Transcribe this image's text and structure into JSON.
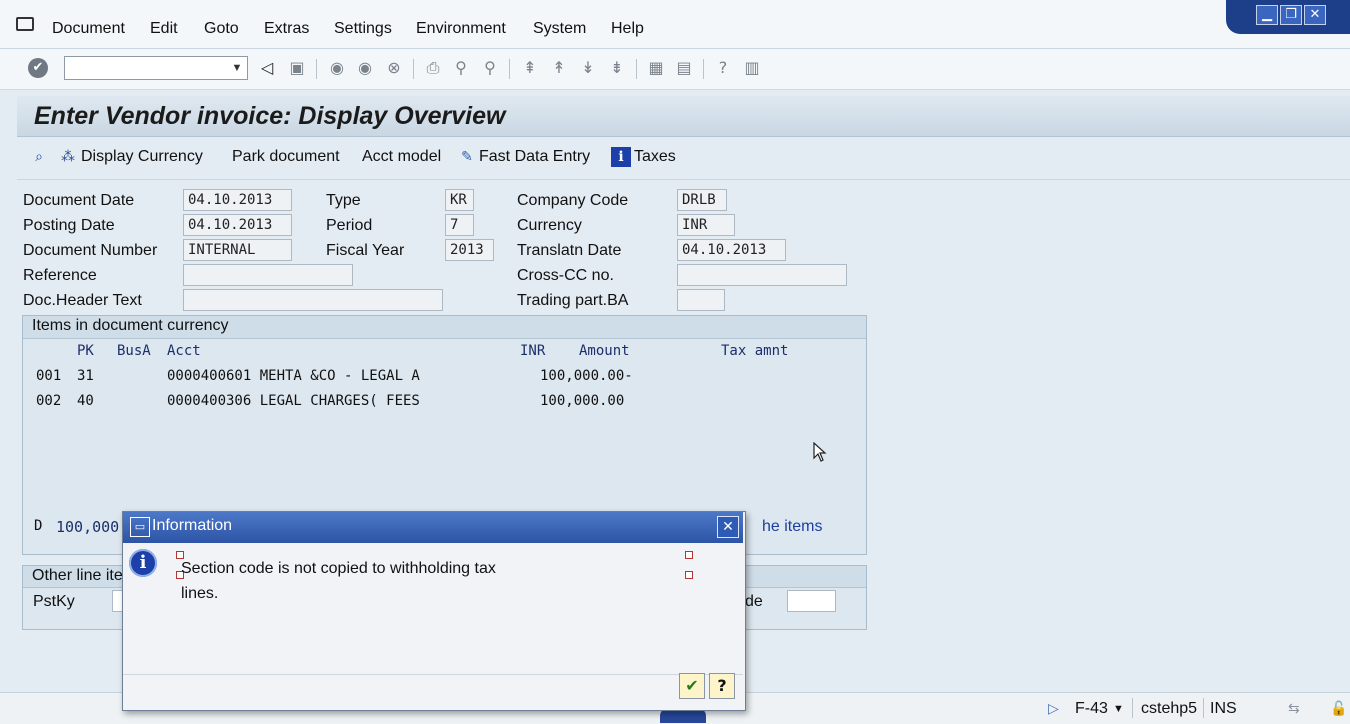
{
  "menu": {
    "items": [
      "Document",
      "Edit",
      "Goto",
      "Extras",
      "Settings",
      "Environment",
      "System",
      "Help"
    ]
  },
  "toolbar": {
    "command_field_value": ""
  },
  "window_controls": {
    "minimize": "▁",
    "restore": "❐",
    "close": "✕"
  },
  "page": {
    "title": "Enter Vendor invoice: Display Overview"
  },
  "app_toolbar": {
    "display_currency": "Display Currency",
    "park_document": "Park document",
    "acct_model": "Acct model",
    "fast_data_entry": "Fast Data Entry",
    "taxes": "Taxes"
  },
  "header": {
    "document_date": {
      "label": "Document Date",
      "value": "04.10.2013"
    },
    "posting_date": {
      "label": "Posting Date",
      "value": "04.10.2013"
    },
    "document_number": {
      "label": "Document Number",
      "value": "INTERNAL"
    },
    "reference": {
      "label": "Reference",
      "value": ""
    },
    "doc_header_text": {
      "label": "Doc.Header Text",
      "value": ""
    },
    "type": {
      "label": "Type",
      "value": "KR"
    },
    "period": {
      "label": "Period",
      "value": "7"
    },
    "fiscal_year": {
      "label": "Fiscal Year",
      "value": "2013"
    },
    "company_code": {
      "label": "Company Code",
      "value": "DRLB"
    },
    "currency": {
      "label": "Currency",
      "value": "INR"
    },
    "translatn_date": {
      "label": "Translatn Date",
      "value": "04.10.2013"
    },
    "cross_cc_no": {
      "label": "Cross-CC no.",
      "value": ""
    },
    "trading_part_ba": {
      "label": "Trading part.BA",
      "value": ""
    }
  },
  "items": {
    "title": "Items in document currency",
    "columns": {
      "pk": "PK",
      "busa": "BusA",
      "acct": "Acct",
      "cur": "INR",
      "amount": "Amount",
      "tax": "Tax amnt"
    },
    "rows": [
      {
        "no": "001",
        "pk": "31",
        "acct": "0000400601 MEHTA &CO - LEGAL A",
        "amount": "100,000.00-"
      },
      {
        "no": "002",
        "pk": "40",
        "acct": "0000400306 LEGAL CHARGES( FEES",
        "amount": "100,000.00"
      }
    ],
    "totals_prefix": "D",
    "totals_value": "100,000",
    "line_items_link": "he items"
  },
  "other_line_item": {
    "title": "Other line ite",
    "pstky_label": "PstKy",
    "right_label": "de"
  },
  "dialog": {
    "title": "Information",
    "message": "Section code is not copied to withholding tax lines.",
    "icon": "info-icon"
  },
  "status_bar": {
    "transaction": "F-43",
    "server": "cstehp5",
    "mode": "INS"
  }
}
